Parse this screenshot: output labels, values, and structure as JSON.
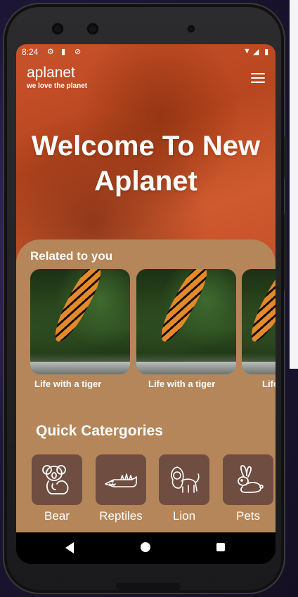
{
  "status_bar": {
    "time": "8:24"
  },
  "header": {
    "title": "aplanet",
    "subtitle": "we love the planet"
  },
  "hero": {
    "title": "Welcome To New Aplanet"
  },
  "related": {
    "title": "Related to you",
    "cards": [
      {
        "label": "Life with a tiger"
      },
      {
        "label": "Life with a tiger"
      },
      {
        "label": "Life with a tiger"
      }
    ]
  },
  "quick": {
    "title": "Quick Catergories",
    "items": [
      {
        "label": "Bear",
        "icon": "koala-icon"
      },
      {
        "label": "Reptiles",
        "icon": "crocodile-icon"
      },
      {
        "label": "Lion",
        "icon": "lion-icon"
      },
      {
        "label": "Pets",
        "icon": "rabbit-icon"
      }
    ]
  },
  "colors": {
    "panel": "#b5865a",
    "category_tile": "#6f4d40",
    "hero": "#c9522b"
  }
}
